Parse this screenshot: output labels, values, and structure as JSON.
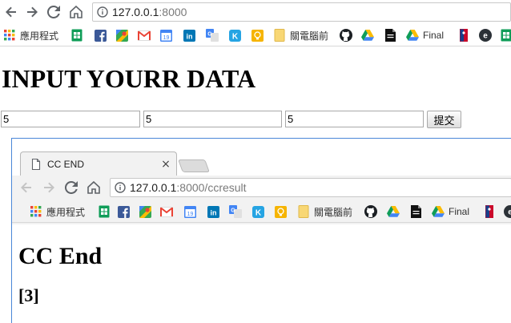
{
  "window1": {
    "address": {
      "host": "127.0.0.1",
      "rest": ":8000"
    },
    "bookmarks": [
      {
        "label": "應用程式",
        "icon": "apps-grid-icon"
      },
      {
        "label": "",
        "icon": "sheets-icon"
      },
      {
        "label": "",
        "icon": "facebook-icon"
      },
      {
        "label": "",
        "icon": "maps-icon"
      },
      {
        "label": "",
        "icon": "gmail-icon"
      },
      {
        "label": "",
        "icon": "calendar-icon"
      },
      {
        "label": "",
        "icon": "linkedin-icon"
      },
      {
        "label": "",
        "icon": "translate-icon"
      },
      {
        "label": "",
        "icon": "k-icon"
      },
      {
        "label": "",
        "icon": "bulb-icon"
      },
      {
        "label": "關電腦前",
        "icon": "folder-icon"
      },
      {
        "label": "",
        "icon": "github-icon"
      },
      {
        "label": "",
        "icon": "drive-icon"
      },
      {
        "label": "",
        "icon": "document-icon"
      },
      {
        "label": "Final",
        "icon": "drive-icon"
      },
      {
        "label": "",
        "icon": "nba-icon"
      },
      {
        "label": "",
        "icon": "e-icon"
      },
      {
        "label": "",
        "icon": "sheets-icon"
      }
    ],
    "heading": "INPUT YOURR DATA",
    "inputs": [
      "5",
      "5",
      "5"
    ],
    "submit_label": "提交"
  },
  "window2": {
    "tab_title": "CC END",
    "tab_close": "×",
    "address": {
      "host": "127.0.0.1",
      "rest": ":8000/ccresult"
    },
    "bookmarks": [
      {
        "label": "應用程式",
        "icon": "apps-grid-icon"
      },
      {
        "label": "",
        "icon": "sheets-icon"
      },
      {
        "label": "",
        "icon": "facebook-icon"
      },
      {
        "label": "",
        "icon": "maps-icon"
      },
      {
        "label": "",
        "icon": "gmail-icon"
      },
      {
        "label": "",
        "icon": "calendar-icon"
      },
      {
        "label": "",
        "icon": "linkedin-icon"
      },
      {
        "label": "",
        "icon": "translate-icon"
      },
      {
        "label": "",
        "icon": "k-icon"
      },
      {
        "label": "",
        "icon": "bulb-icon"
      },
      {
        "label": "關電腦前",
        "icon": "folder-icon"
      },
      {
        "label": "",
        "icon": "github-icon"
      },
      {
        "label": "",
        "icon": "drive-icon"
      },
      {
        "label": "",
        "icon": "document-icon"
      },
      {
        "label": "Final",
        "icon": "drive-icon"
      },
      {
        "label": "",
        "icon": "nba-icon"
      },
      {
        "label": "",
        "icon": "e-icon"
      }
    ],
    "heading": "CC End",
    "result": "[3]"
  },
  "colors": {
    "window_border": "#4a87d8",
    "nav_icon": "#5f6368",
    "nav_icon_disabled": "#c4c4c4"
  }
}
